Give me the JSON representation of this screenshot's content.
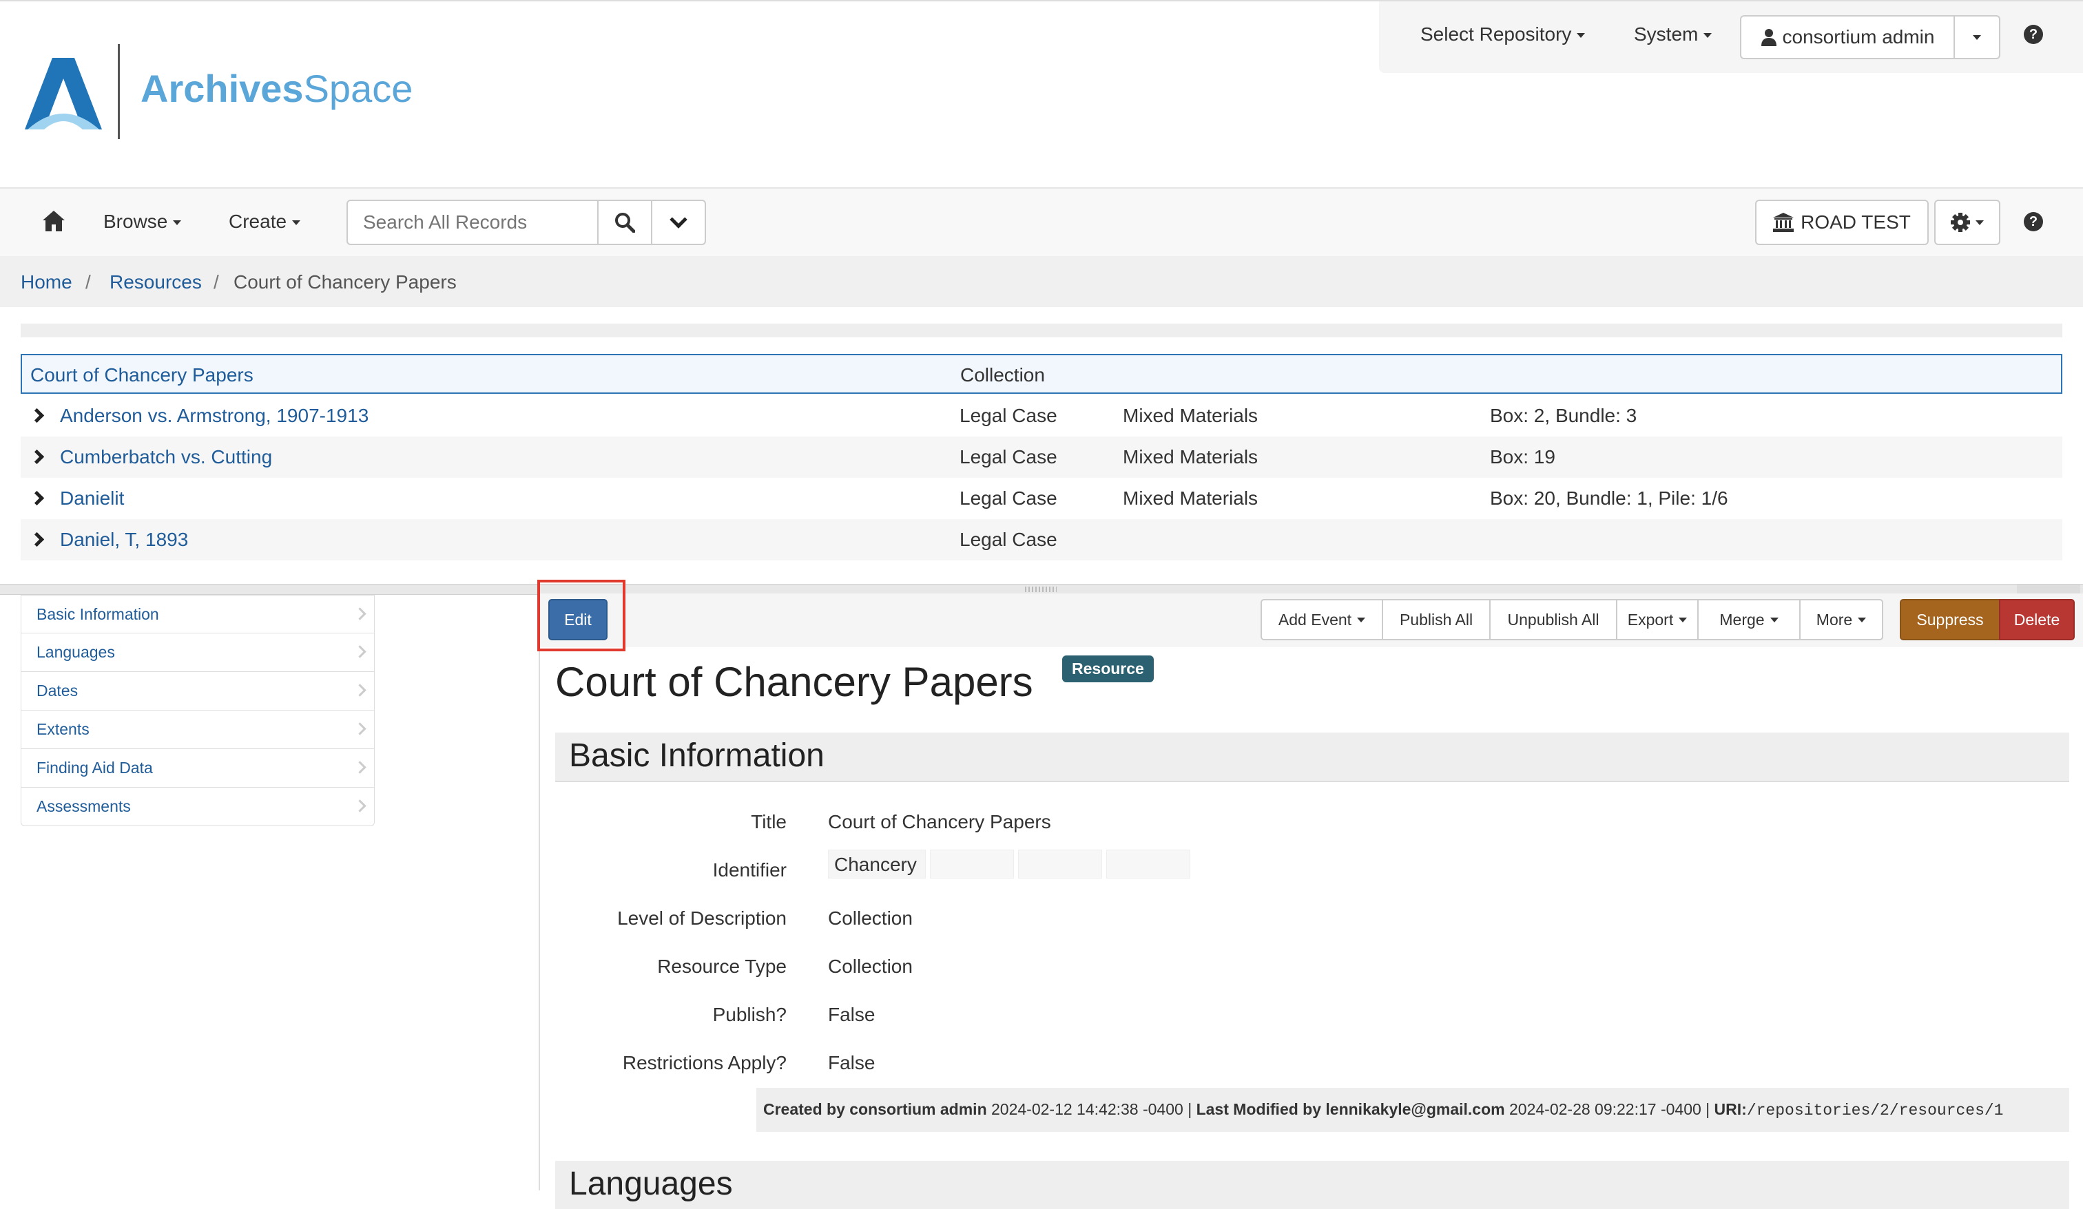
{
  "brand": {
    "name_bold": "Archives",
    "name_light": "Space"
  },
  "topbar": {
    "select_repository": "Select Repository",
    "system": "System",
    "user": "consortium admin"
  },
  "nav": {
    "browse": "Browse",
    "create": "Create",
    "search_placeholder": "Search All Records",
    "repository": "ROAD TEST"
  },
  "breadcrumb": {
    "home": "Home",
    "resources": "Resources",
    "current": "Court of Chancery Papers"
  },
  "tree": {
    "root": {
      "title": "Court of Chancery Papers",
      "level": "Collection"
    },
    "rows": [
      {
        "title": "Anderson vs. Armstrong, 1907-1913",
        "level": "Legal Case",
        "type": "Mixed Materials",
        "container": "Box: 2, Bundle: 3"
      },
      {
        "title": "Cumberbatch vs. Cutting",
        "level": "Legal Case",
        "type": "Mixed Materials",
        "container": "Box: 19"
      },
      {
        "title": "Danielit",
        "level": "Legal Case",
        "type": "Mixed Materials",
        "container": "Box: 20, Bundle: 1, Pile: 1/6"
      },
      {
        "title": "Daniel, T, 1893",
        "level": "Legal Case",
        "type": "",
        "container": ""
      }
    ]
  },
  "sidebar": {
    "items": [
      {
        "label": "Basic Information"
      },
      {
        "label": "Languages"
      },
      {
        "label": "Dates"
      },
      {
        "label": "Extents"
      },
      {
        "label": "Finding Aid Data"
      },
      {
        "label": "Assessments"
      }
    ]
  },
  "toolbar": {
    "edit": "Edit",
    "add_event": "Add Event",
    "publish_all": "Publish All",
    "unpublish_all": "Unpublish All",
    "export": "Export",
    "merge": "Merge",
    "more": "More",
    "suppress": "Suppress",
    "delete": "Delete"
  },
  "record": {
    "title": "Court of Chancery Papers",
    "badge": "Resource",
    "section_basic": "Basic Information",
    "section_languages": "Languages",
    "fields": {
      "title_label": "Title",
      "title_value": "Court of Chancery Papers",
      "identifier_label": "Identifier",
      "identifier_value": "Chancery",
      "level_label": "Level of Description",
      "level_value": "Collection",
      "type_label": "Resource Type",
      "type_value": "Collection",
      "publish_label": "Publish?",
      "publish_value": "False",
      "restrictions_label": "Restrictions Apply?",
      "restrictions_value": "False"
    },
    "meta": {
      "created_label": "Created by consortium admin",
      "created_date": " 2024-02-12 14:42:38 -0400 | ",
      "modified_label": "Last Modified by lennikakyle@gmail.com",
      "modified_date": " 2024-02-28 09:22:17 -0400 | ",
      "uri_label": "URI:",
      "uri_value": "/repositories/2/resources/1"
    }
  },
  "colors": {
    "brand_blue": "#5aa6d9",
    "link": "#1f5c99",
    "edit_button": "#3b6ea8",
    "suppress": "#a5651e",
    "delete": "#b93733",
    "badge": "#2b6171",
    "highlight": "#e03a2f"
  }
}
